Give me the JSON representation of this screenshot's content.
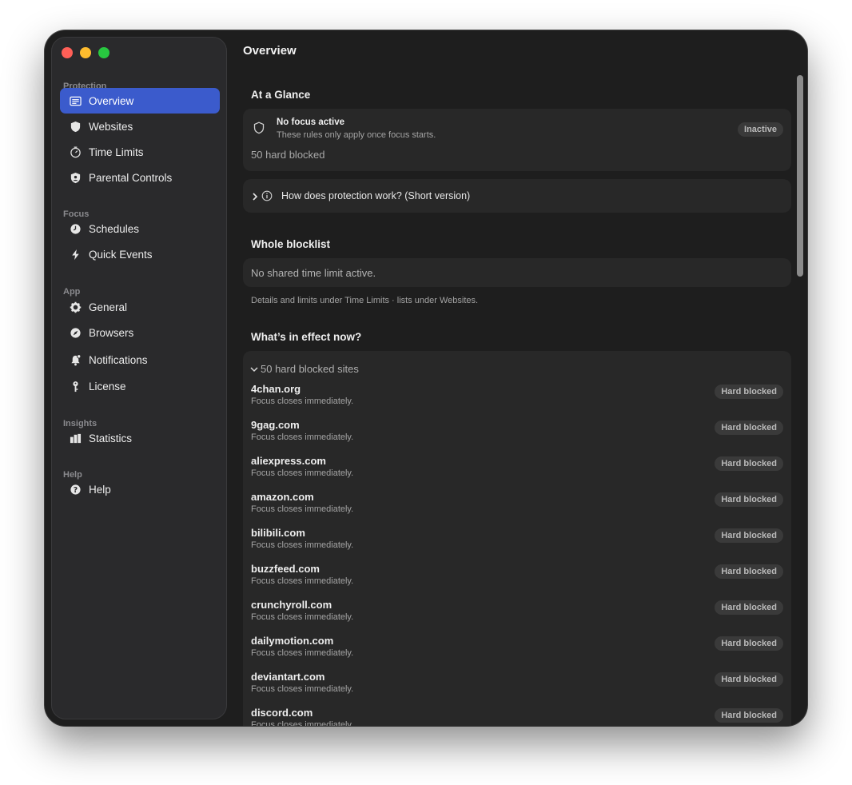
{
  "sidebar": {
    "sections": {
      "protection": "Protection",
      "focus": "Focus",
      "app": "App",
      "insights": "Insights",
      "help": "Help"
    },
    "items": {
      "overview": "Overview",
      "websites": "Websites",
      "time_limits": "Time Limits",
      "parental_controls": "Parental Controls",
      "schedules": "Schedules",
      "quick_events": "Quick Events",
      "general": "General",
      "browsers": "Browsers",
      "notifications": "Notifications",
      "license": "License",
      "statistics": "Statistics",
      "help": "Help"
    }
  },
  "main": {
    "title": "Overview",
    "at_a_glance": {
      "heading": "At a Glance",
      "status_title": "No focus active",
      "status_sub": "These rules only apply once focus starts.",
      "status_badge": "Inactive",
      "hard_blocked_count": "50 hard blocked"
    },
    "how_it_works": "How does protection work? (Short version)",
    "whole_blocklist": {
      "heading": "Whole blocklist",
      "time_limit_text": "No shared time limit active.",
      "note": "Details and limits under Time Limits · lists under Websites."
    },
    "in_effect": {
      "heading": "What’s in effect now?",
      "group_label": "50 hard blocked sites",
      "sites": [
        {
          "name": "4chan.org",
          "sub": "Focus closes immediately.",
          "badge": "Hard blocked"
        },
        {
          "name": "9gag.com",
          "sub": "Focus closes immediately.",
          "badge": "Hard blocked"
        },
        {
          "name": "aliexpress.com",
          "sub": "Focus closes immediately.",
          "badge": "Hard blocked"
        },
        {
          "name": "amazon.com",
          "sub": "Focus closes immediately.",
          "badge": "Hard blocked"
        },
        {
          "name": "bilibili.com",
          "sub": "Focus closes immediately.",
          "badge": "Hard blocked"
        },
        {
          "name": "buzzfeed.com",
          "sub": "Focus closes immediately.",
          "badge": "Hard blocked"
        },
        {
          "name": "crunchyroll.com",
          "sub": "Focus closes immediately.",
          "badge": "Hard blocked"
        },
        {
          "name": "dailymotion.com",
          "sub": "Focus closes immediately.",
          "badge": "Hard blocked"
        },
        {
          "name": "deviantart.com",
          "sub": "Focus closes immediately.",
          "badge": "Hard blocked"
        },
        {
          "name": "discord.com",
          "sub": "Focus closes immediately.",
          "badge": "Hard blocked"
        }
      ]
    }
  },
  "colors": {
    "accent": "#3b5bcc",
    "window_bg": "#1e1e1e",
    "sidebar_bg": "#2a2a2c",
    "card_bg": "#282828"
  }
}
